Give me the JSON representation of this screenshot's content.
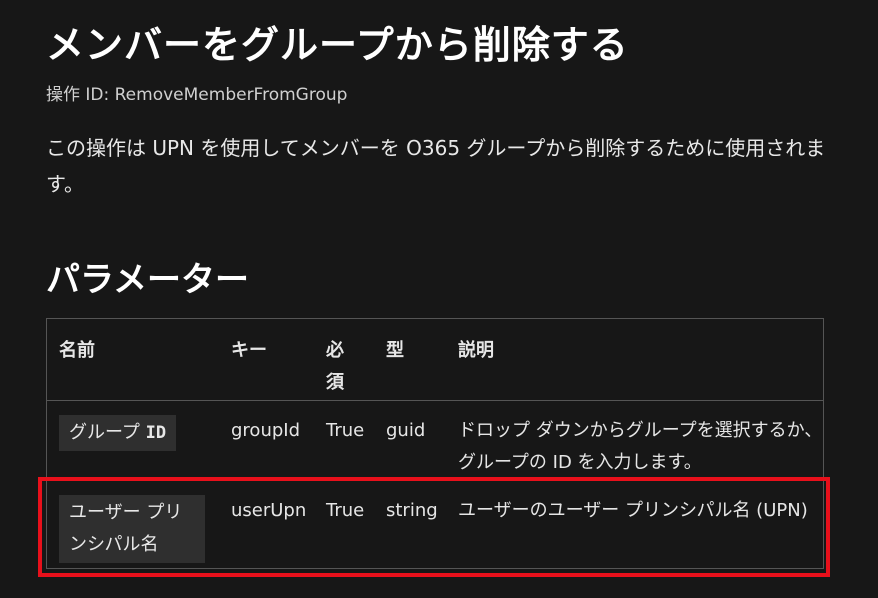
{
  "page": {
    "title": "メンバーをグループから削除する",
    "operation_id": "操作 ID:  RemoveMemberFromGroup",
    "description": "この操作は UPN を使用してメンバーを O365 グループから削除するために使用されます。",
    "params_heading": "パラメーター"
  },
  "table": {
    "headers": [
      "名前",
      "キー",
      "必須",
      "型",
      "説明"
    ],
    "rows": [
      {
        "name_text": "グループ ",
        "name_code": "ID",
        "key": "groupId",
        "required": "True",
        "type": "guid",
        "description": "ドロップ ダウンからグループを選択するか、グループの ID を入力します。"
      },
      {
        "name_text": "ユーザー プリンシパル名",
        "name_code": "",
        "key": "userUpn",
        "required": "True",
        "type": "string",
        "description": "ユーザーのユーザー プリンシパル名 (UPN)"
      }
    ]
  },
  "colors": {
    "background": "#171717",
    "highlight": "#e8101b",
    "chip": "#2f2f2f"
  }
}
